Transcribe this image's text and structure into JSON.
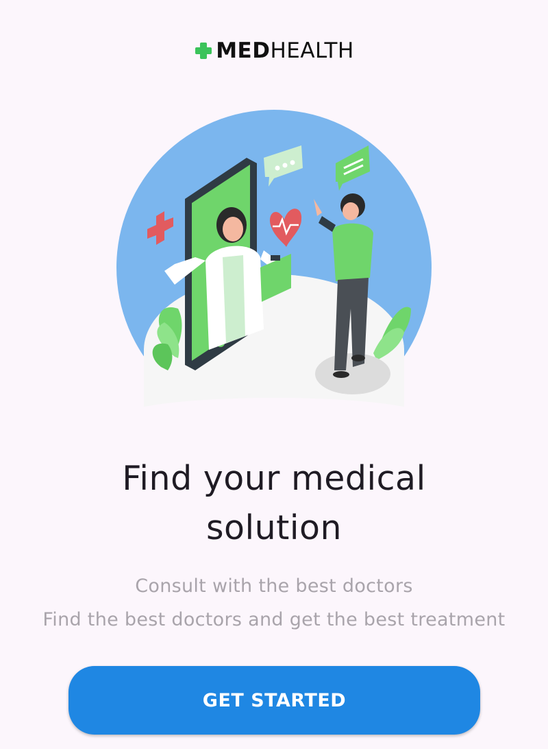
{
  "brand": {
    "name_bold": "MED",
    "name_light": "HEALTH",
    "icon": "plus-icon",
    "icon_color": "#3bc35a"
  },
  "illustration": {
    "description_icon": "telemedicine-illustration",
    "background_color": "#7bb6ee"
  },
  "onboarding": {
    "title_line1": "Find your medical",
    "title_line2": "solution",
    "subtitle_line1": "Consult with the best doctors",
    "subtitle_line2": "Find the best doctors and get the best treatment"
  },
  "cta": {
    "label": "GET STARTED",
    "color": "#1f87e3"
  }
}
